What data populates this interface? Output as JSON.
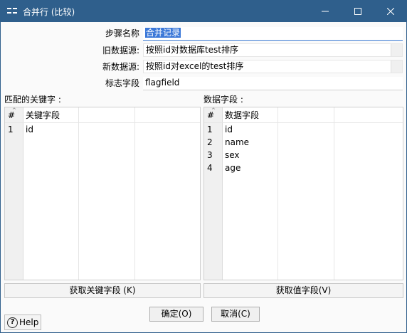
{
  "window": {
    "title": "合并行 (比较)"
  },
  "form": {
    "step_name_label": "步骤名称",
    "step_name_value": "合并记录",
    "old_source_label": "旧数据源:",
    "old_source_value": "按照id对数据库test排序",
    "new_source_label": "新数据源:",
    "new_source_value": "按照id对excel的test排序",
    "flag_field_label": "标志字段",
    "flag_field_value": "flagfield"
  },
  "key_fields": {
    "title": "匹配的关键字 :",
    "col_num": "#",
    "col_name": "关键字段",
    "rows": [
      {
        "num": "1",
        "name": "id"
      }
    ],
    "get_button": "获取关键字段 (K)"
  },
  "data_fields": {
    "title": "数据字段 :",
    "col_num": "#",
    "col_name": "数据字段",
    "rows": [
      {
        "num": "1",
        "name": "id"
      },
      {
        "num": "2",
        "name": "name"
      },
      {
        "num": "3",
        "name": "sex"
      },
      {
        "num": "4",
        "name": "age"
      }
    ],
    "get_button": "获取值字段(V)"
  },
  "buttons": {
    "ok": "确定(O)",
    "cancel": "取消(C)",
    "help": "Help"
  },
  "icons": {
    "app": "merge-rows-icon",
    "minimize": "minimize-icon",
    "maximize": "maximize-icon",
    "close": "close-icon",
    "help": "help-icon"
  },
  "colors": {
    "titlebar": "#2f5f8c",
    "selection": "#3b78d8"
  }
}
